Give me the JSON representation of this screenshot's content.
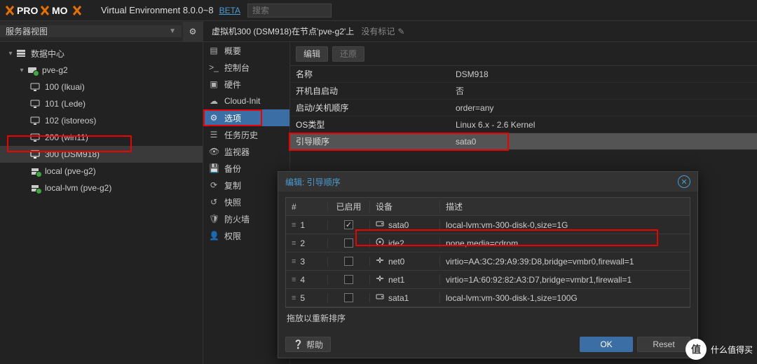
{
  "header": {
    "product": "Virtual Environment 8.0.0~8",
    "beta": "BETA",
    "search_placeholder": "搜索"
  },
  "sidebar": {
    "view_label": "服务器视图",
    "items": [
      {
        "label": "数据中心",
        "type": "dc"
      },
      {
        "label": "pve-g2",
        "type": "node"
      },
      {
        "label": "100 (Ikuai)",
        "type": "vm"
      },
      {
        "label": "101 (Lede)",
        "type": "vm"
      },
      {
        "label": "102 (istoreos)",
        "type": "vm"
      },
      {
        "label": "200 (win11)",
        "type": "vm"
      },
      {
        "label": "300 (DSM918)",
        "type": "vm",
        "selected": true
      },
      {
        "label": "local (pve-g2)",
        "type": "storage"
      },
      {
        "label": "local-lvm (pve-g2)",
        "type": "storage"
      }
    ]
  },
  "breadcrumb": {
    "title": "虚拟机300 (DSM918)在节点'pve-g2'上",
    "tags": "没有标记"
  },
  "menu": {
    "items": [
      "概要",
      "控制台",
      "硬件",
      "Cloud-Init",
      "选项",
      "任务历史",
      "监视器",
      "备份",
      "复制",
      "快照",
      "防火墙",
      "权限"
    ],
    "active_index": 4
  },
  "options_toolbar": {
    "edit": "编辑",
    "revert": "还原"
  },
  "options_rows": [
    {
      "k": "名称",
      "v": "DSM918"
    },
    {
      "k": "开机自启动",
      "v": "否"
    },
    {
      "k": "启动/关机顺序",
      "v": "order=any"
    },
    {
      "k": "OS类型",
      "v": "Linux 6.x - 2.6 Kernel"
    },
    {
      "k": "引导顺序",
      "v": "sata0",
      "selected": true
    }
  ],
  "dialog": {
    "title": "编辑: 引导顺序",
    "col_idx": "#",
    "col_enabled": "已启用",
    "col_device": "设备",
    "col_desc": "描述",
    "rows": [
      {
        "idx": "1",
        "enabled": true,
        "icon": "hdd",
        "dev": "sata0",
        "desc": "local-lvm:vm-300-disk-0,size=1G"
      },
      {
        "idx": "2",
        "enabled": false,
        "icon": "cd",
        "dev": "ide2",
        "desc": "none,media=cdrom"
      },
      {
        "idx": "3",
        "enabled": false,
        "icon": "net",
        "dev": "net0",
        "desc": "virtio=AA:3C:29:A9:39:D8,bridge=vmbr0,firewall=1"
      },
      {
        "idx": "4",
        "enabled": false,
        "icon": "net",
        "dev": "net1",
        "desc": "virtio=1A:60:92:82:A3:D7,bridge=vmbr1,firewall=1"
      },
      {
        "idx": "5",
        "enabled": false,
        "icon": "hdd",
        "dev": "sata1",
        "desc": "local-lvm:vm-300-disk-1,size=100G"
      }
    ],
    "hint": "拖放以重新排序",
    "help": "帮助",
    "ok": "OK",
    "reset": "Reset"
  },
  "watermark": {
    "badge": "值",
    "text": "什么值得买"
  }
}
